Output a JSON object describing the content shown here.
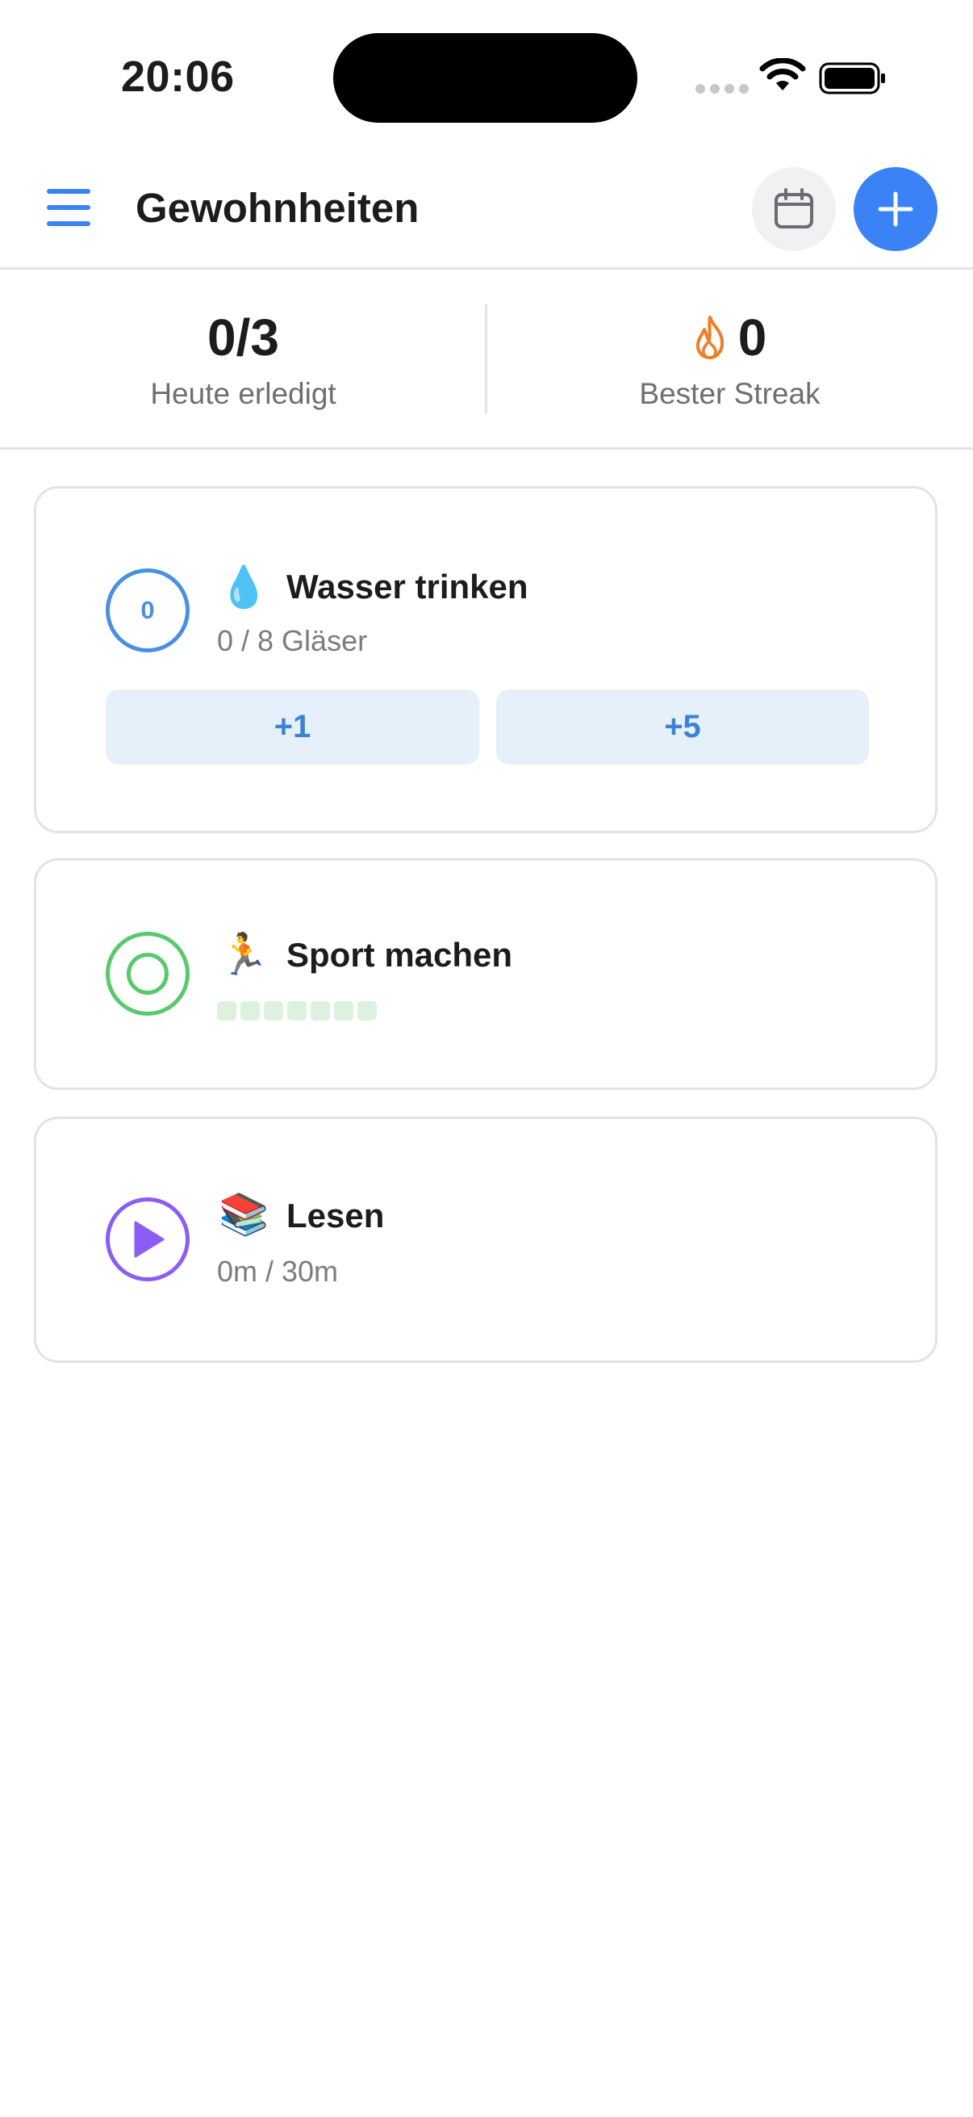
{
  "status_bar": {
    "time": "20:06"
  },
  "header": {
    "title": "Gewohnheiten",
    "accent_color": "#3b82f6"
  },
  "stats": {
    "completed_value": "0/3",
    "completed_label": "Heute erledigt",
    "streak_value": "0",
    "streak_label": "Bester Streak"
  },
  "habits": [
    {
      "emoji": "💧",
      "name": "Wasser trinken",
      "ring_count": "0",
      "progress_text": "0 / 8 Gläser",
      "buttons": [
        "+1",
        "+5"
      ],
      "color": "#4a90e2"
    },
    {
      "emoji": "🏃",
      "name": "Sport machen",
      "week_days": 7,
      "color": "#58c96d"
    },
    {
      "emoji": "📚",
      "name": "Lesen",
      "progress_text": "0m / 30m",
      "color": "#8b5cf6"
    }
  ]
}
